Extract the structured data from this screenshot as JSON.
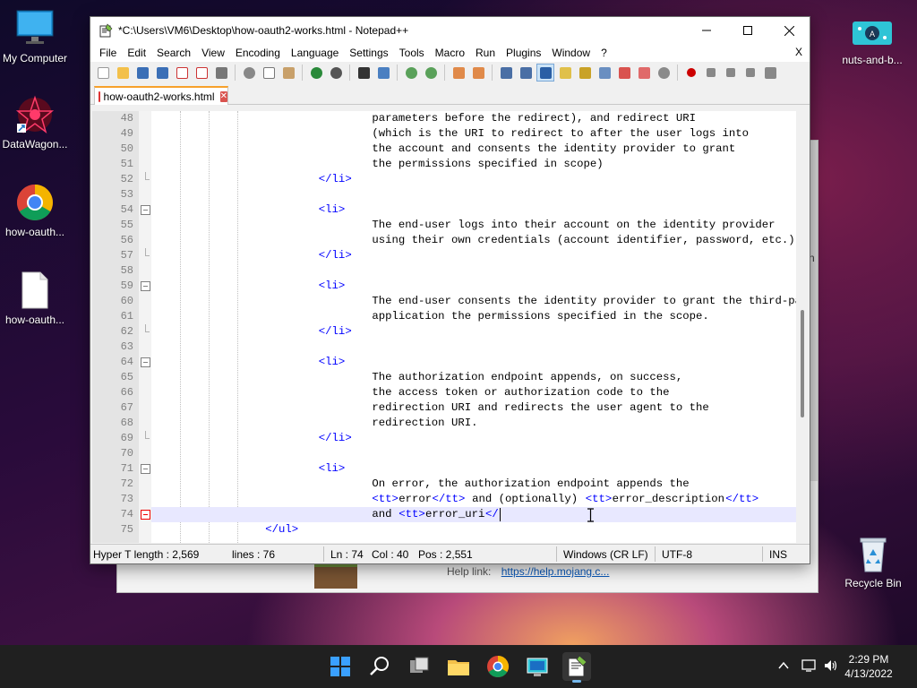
{
  "desktop": {
    "icons": [
      {
        "label": "My Computer"
      },
      {
        "label": "DataWagon..."
      },
      {
        "label": "how-oauth..."
      },
      {
        "label": "how-oauth..."
      },
      {
        "label": "nuts-and-b..."
      },
      {
        "label": "Recycle Bin"
      }
    ]
  },
  "background_window": {
    "help_label": "Help link:",
    "help_link": "https://help.mojang.c...",
    "side_char": "n"
  },
  "window": {
    "title": "*C:\\Users\\VM6\\Desktop\\how-oauth2-works.html - Notepad++",
    "menu": [
      "File",
      "Edit",
      "Search",
      "View",
      "Encoding",
      "Language",
      "Settings",
      "Tools",
      "Macro",
      "Run",
      "Plugins",
      "Window",
      "?"
    ],
    "menu_close": "X",
    "tab_label": "how-oauth2-works.html"
  },
  "editor": {
    "lines": [
      {
        "n": "48",
        "t": "parameters before the redirect), and redirect URI"
      },
      {
        "n": "49",
        "t": "(which is the URI to redirect to after the user logs into"
      },
      {
        "n": "50",
        "t": "the account and consents the identity provider to grant"
      },
      {
        "n": "51",
        "t": "the permissions specified in scope)"
      },
      {
        "n": "52",
        "t": "</li>"
      },
      {
        "n": "53",
        "t": ""
      },
      {
        "n": "54",
        "t": "<li>"
      },
      {
        "n": "55",
        "t": "The end-user logs into their account on the identity provider"
      },
      {
        "n": "56",
        "t": "using their own credentials (account identifier, password, etc.)"
      },
      {
        "n": "57",
        "t": "</li>"
      },
      {
        "n": "58",
        "t": ""
      },
      {
        "n": "59",
        "t": "<li>"
      },
      {
        "n": "60",
        "t": "The end-user consents the identity provider to grant the third-party"
      },
      {
        "n": "61",
        "t": "application the permissions specified in the scope."
      },
      {
        "n": "62",
        "t": "</li>"
      },
      {
        "n": "63",
        "t": ""
      },
      {
        "n": "64",
        "t": "<li>"
      },
      {
        "n": "65",
        "t": "The authorization endpoint appends, on success,"
      },
      {
        "n": "66",
        "t": "the access token or authorization code to the"
      },
      {
        "n": "67",
        "t": "redirection URI and redirects the user agent to the"
      },
      {
        "n": "68",
        "t": "redirection URI."
      },
      {
        "n": "69",
        "t": "</li>"
      },
      {
        "n": "70",
        "t": ""
      },
      {
        "n": "71",
        "t": "<li>"
      },
      {
        "n": "72",
        "t": "On error, the authorization endpoint appends the"
      },
      {
        "n": "73a",
        "t": "<tt>"
      },
      {
        "n": "73",
        "t": "error"
      },
      {
        "n": "73b",
        "t": "</tt>"
      },
      {
        "n": "73c",
        "t": " and (optionally) "
      },
      {
        "n": "73d",
        "t": "<tt>"
      },
      {
        "n": "73e",
        "t": "error_description"
      },
      {
        "n": "73f",
        "t": "</tt>"
      },
      {
        "n": "74a",
        "t": "and "
      },
      {
        "n": "74b",
        "t": "<tt>"
      },
      {
        "n": "74c",
        "t": "error_uri"
      },
      {
        "n": "74d",
        "t": "</"
      },
      {
        "n": "75",
        "t": "</ul>"
      }
    ],
    "line_numbers": [
      "48",
      "49",
      "50",
      "51",
      "52",
      "53",
      "54",
      "55",
      "56",
      "57",
      "58",
      "59",
      "60",
      "61",
      "62",
      "63",
      "64",
      "65",
      "66",
      "67",
      "68",
      "69",
      "70",
      "71",
      "72",
      "73",
      "74",
      "75"
    ]
  },
  "status": {
    "length": "Hyper T length : 2,569",
    "lines": "lines : 76",
    "ln": "Ln : 74",
    "col": "Col : 40",
    "pos": "Pos : 2,551",
    "eol": "Windows (CR LF)",
    "encoding": "UTF-8",
    "mode": "INS"
  },
  "taskbar": {
    "time": "2:29 PM",
    "date": "4/13/2022"
  },
  "colors": {
    "tag": "#0000ff",
    "current_line": "#e8e8ff",
    "tab_accent": "#f7a12b",
    "fold_active": "#e00000"
  }
}
